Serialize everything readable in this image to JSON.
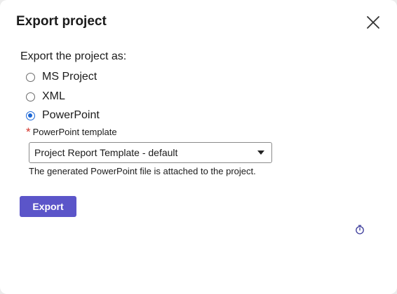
{
  "dialog": {
    "title": "Export project",
    "prompt": "Export the project as:",
    "options": [
      {
        "label": "MS Project",
        "checked": false
      },
      {
        "label": "XML",
        "checked": false
      },
      {
        "label": "PowerPoint",
        "checked": true
      }
    ],
    "template_field": {
      "required_mark": "*",
      "label": "PowerPoint template",
      "value": "Project Report Template - default"
    },
    "hint": "The generated PowerPoint file is attached to the project.",
    "export_label": "Export",
    "icons": {
      "close": "close-icon",
      "timer": "stopwatch-icon"
    },
    "colors": {
      "primary_button": "#5b55c9",
      "radio_selected": "#1a66d6",
      "required": "#d4352b"
    }
  }
}
